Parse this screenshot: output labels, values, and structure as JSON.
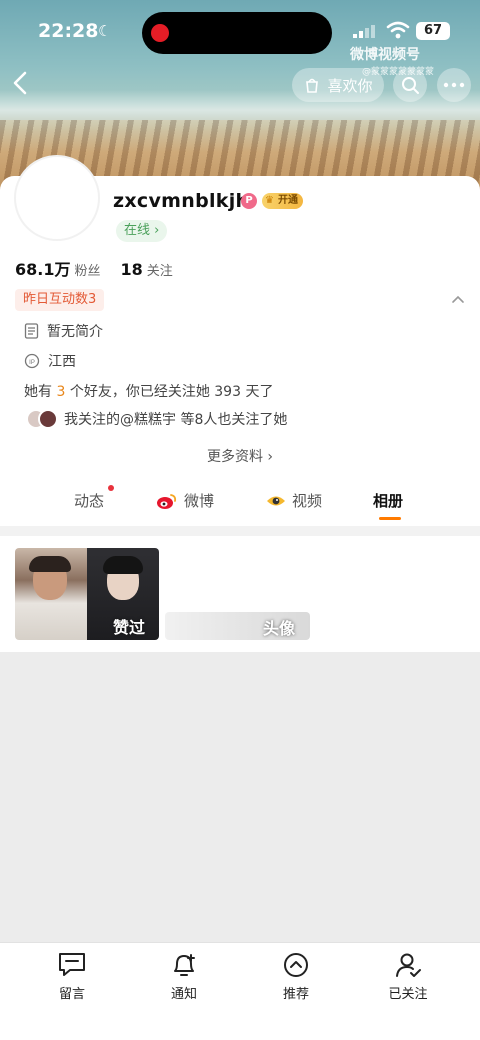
{
  "status_bar": {
    "time": "22:28",
    "battery": "67"
  },
  "watermark": {
    "brand": "微博视频号",
    "sub": "@蒙蒙蒙蒙蒙蒙蒙"
  },
  "header": {
    "like_label": "喜欢你"
  },
  "profile": {
    "username": "zxcvmnblkjh",
    "badge_p": "P",
    "vip_label": "开通",
    "online_label": "在线 ›",
    "followers_count": "68.1万",
    "followers_label": "粉丝",
    "following_count": "18",
    "following_label": "关注",
    "interact_label": "昨日互动数3",
    "bio": "暂无简介",
    "location": "江西",
    "friends_prefix": "她有 ",
    "friends_count": "3",
    "friends_suffix": " 个好友，你已经关注她 393 天了",
    "mutual_text": "我关注的@糕糕宇  等8人也关注了她",
    "more_label": "更多资料 ›"
  },
  "tabs": [
    {
      "label": "动态"
    },
    {
      "label": "微博"
    },
    {
      "label": "视频"
    },
    {
      "label": "相册"
    }
  ],
  "album": {
    "tile1_label": "赞过",
    "tile2_label": "头像"
  },
  "bottom_bar": [
    {
      "label": "留言",
      "icon": "message-icon"
    },
    {
      "label": "通知",
      "icon": "bell-plus-icon"
    },
    {
      "label": "推荐",
      "icon": "chevron-up-circle-icon"
    },
    {
      "label": "已关注",
      "icon": "user-check-icon"
    }
  ],
  "colors": {
    "accent_orange": "#ff7a00",
    "interact_red": "#e35a36",
    "online_green": "#4aa05a",
    "record_red": "#e51d26"
  }
}
